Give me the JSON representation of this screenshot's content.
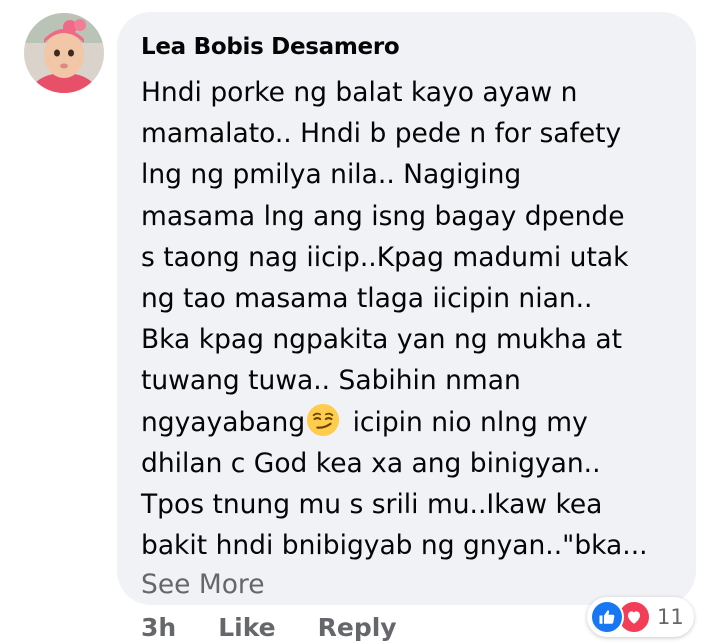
{
  "comment": {
    "author": "Lea Bobis Desamero",
    "lines": [
      "Hndi porke ng balat kayo ayaw n",
      "mamalato.. Hndi b pede n for safety",
      "lng ng pmilya nila.. Nagiging",
      "masama lng ang isng bagay dpende",
      "s taong nag iicip..Kpag madumi utak",
      "ng tao masama tlaga iicipin nian..",
      "Bka kpag ngpakita yan ng mukha at",
      "tuwang tuwa.. Sabihin nman",
      "dhilan c God kea xa ang binigyan..",
      "Tpos tnung mu s srili mu..Ikaw kea",
      "bakit hndi bnibigyab ng gnyan..\"bka..."
    ],
    "emoji_line_before": "ngyayabang",
    "emoji_line_after": " icipin nio nlng my",
    "emoji_icon": "smirking-face-emoji",
    "see_more": "See More"
  },
  "actions": {
    "time": "3h",
    "like": "Like",
    "reply": "Reply"
  },
  "reactions": {
    "icons": [
      "like-icon",
      "love-icon"
    ],
    "count": "11",
    "colors": {
      "like": "#1877f2",
      "love": "#f33e58"
    }
  }
}
